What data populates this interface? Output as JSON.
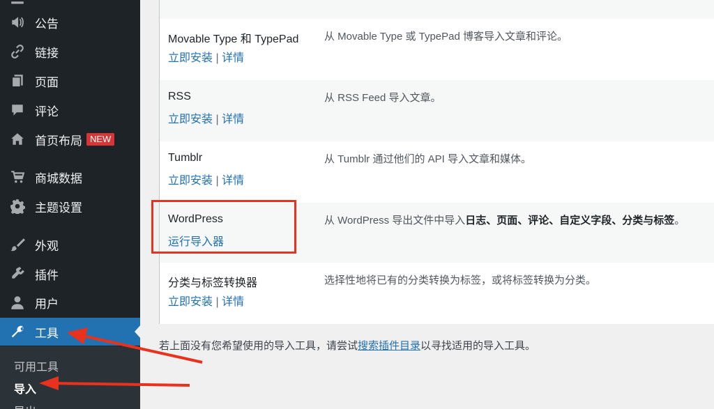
{
  "sidebar": {
    "items": [
      {
        "label": "公告",
        "icon": "megaphone-icon"
      },
      {
        "label": "链接",
        "icon": "link-icon"
      },
      {
        "label": "页面",
        "icon": "page-icon"
      },
      {
        "label": "评论",
        "icon": "comment-icon"
      },
      {
        "label": "首页布局",
        "icon": "home-icon",
        "badge": "NEW"
      },
      {
        "label": "商城数据",
        "icon": "cart-icon"
      },
      {
        "label": "主题设置",
        "icon": "gear-icon"
      },
      {
        "label": "外观",
        "icon": "brush-icon"
      },
      {
        "label": "插件",
        "icon": "plugin-icon"
      },
      {
        "label": "用户",
        "icon": "user-icon"
      },
      {
        "label": "工具",
        "icon": "wrench-icon",
        "current": true
      }
    ],
    "submenu": [
      {
        "label": "可用工具"
      },
      {
        "label": "导入",
        "active": true
      },
      {
        "label": "导出"
      }
    ]
  },
  "importers": [
    {
      "name": "Movable Type 和 TypePad",
      "install": "立即安装",
      "sep": "|",
      "details": "详情",
      "description": "从 Movable Type 或 TypePad 博客导入文章和评论。"
    },
    {
      "name": "RSS",
      "install": "立即安装",
      "sep": "|",
      "details": "详情",
      "description": "从 RSS Feed 导入文章。"
    },
    {
      "name": "Tumblr",
      "install": "立即安装",
      "sep": "|",
      "details": "详情",
      "description": "从 Tumblr 通过他们的 API 导入文章和媒体。"
    },
    {
      "name": "WordPress",
      "run": "运行导入器",
      "description_prefix": "从 WordPress 导出文件中导入",
      "description_bold": "日志、页面、评论、自定义字段、分类与标签",
      "description_suffix": "。"
    },
    {
      "name": "分类与标签转换器",
      "install": "立即安装",
      "sep": "|",
      "details": "详情",
      "description": "选择性地将已有的分类转换为标签，或将标签转换为分类。"
    }
  ],
  "footer": {
    "prefix": "若上面没有您希望使用的导入工具，请尝试",
    "link": "搜索插件目录",
    "suffix": "以寻找适用的导入工具。"
  },
  "colors": {
    "accent": "#2271b1",
    "highlight": "#e8321e",
    "badge": "#d63638"
  }
}
